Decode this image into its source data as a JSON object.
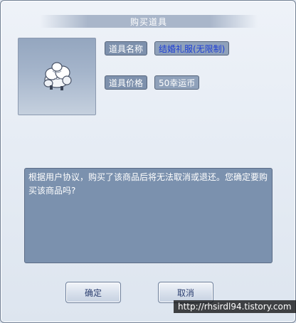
{
  "dialog": {
    "title": "购买道具"
  },
  "item": {
    "icon": "wedding-dress-icon",
    "name_label": "道具名称",
    "name_value": "结婚礼服(无限制)",
    "price_label": "道具价格",
    "price_value": "50幸运币"
  },
  "message": {
    "text": "根据用户协议，购买了该商品后将无法取消或退还。您确定要购买该商品吗?"
  },
  "buttons": {
    "confirm_label": "确定",
    "cancel_label": "取消"
  },
  "watermark": {
    "text": "http://rhsirdl94.tistory.com"
  },
  "colors": {
    "accent_blue": "#1d3ed6",
    "label_bg": "#7e91ad",
    "message_bg": "#7b91ae"
  }
}
